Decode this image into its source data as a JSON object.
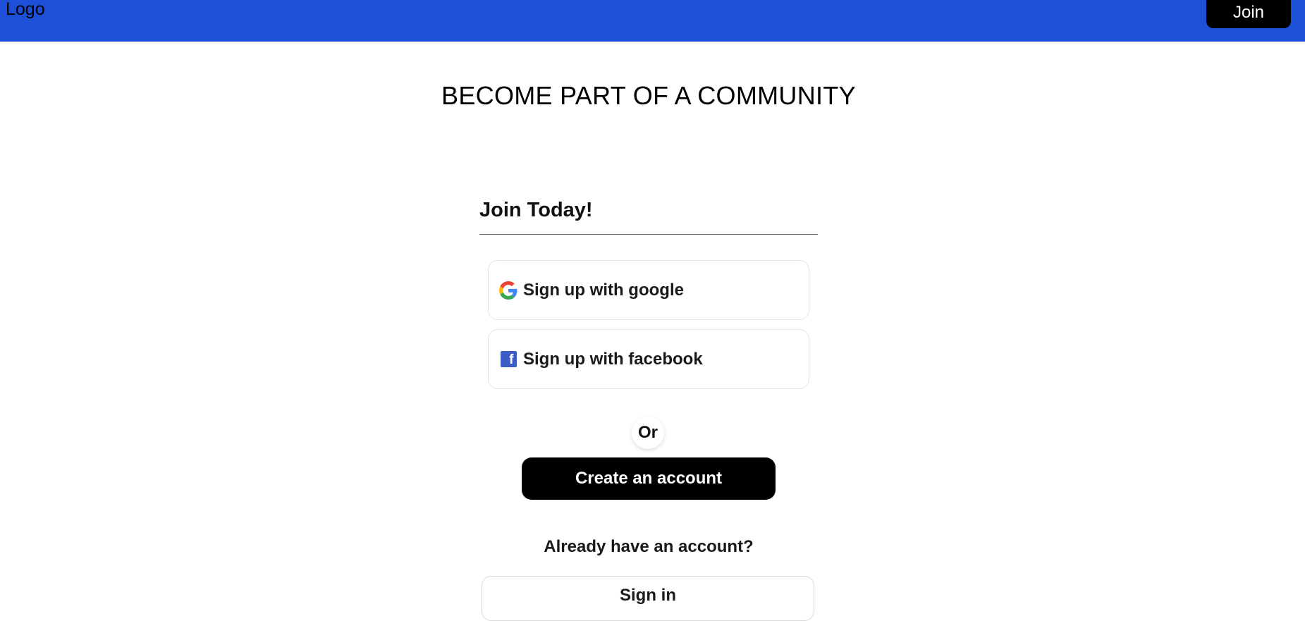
{
  "header": {
    "logo_text": "Logo",
    "join_label": "Join",
    "background_color": "#1e4fd8"
  },
  "main": {
    "title": "BECOME PART OF A COMMUNITY",
    "form_heading": "Join Today!",
    "google_label": "Sign up with google",
    "google_icon": "google-icon",
    "facebook_label": "Sign up with facebook",
    "facebook_icon": "facebook-icon",
    "facebook_icon_glyph": "f",
    "or_label": "Or",
    "create_account_label": "Create an account",
    "already_have_account": "Already have an account?",
    "sign_in_label": "Sign in"
  }
}
